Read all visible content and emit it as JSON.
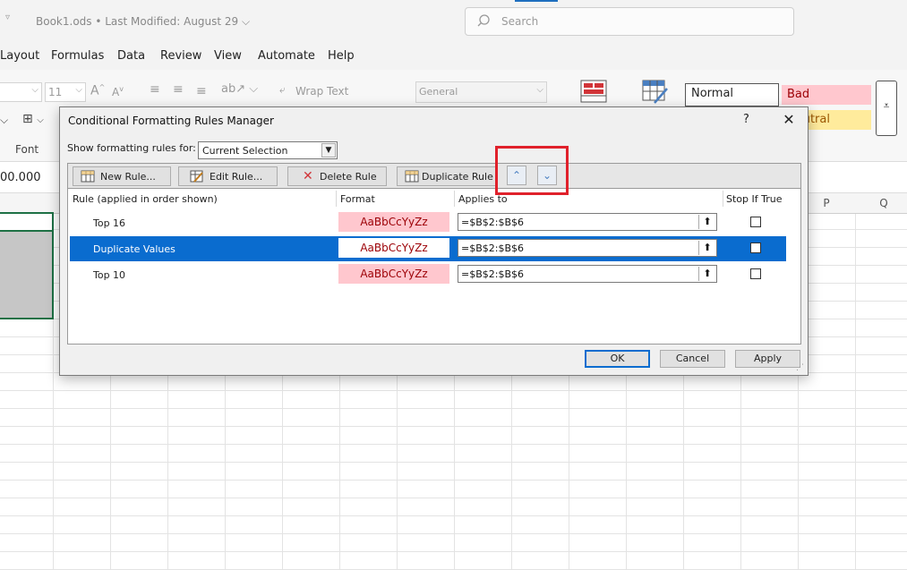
{
  "titlebar": {
    "doc_title": "Book1.ods • Last Modified: August 29 ⌵",
    "search_placeholder": "Search"
  },
  "menu": {
    "items": [
      "Layout",
      "Formulas",
      "Data",
      "Review",
      "View",
      "Automate",
      "Help"
    ]
  },
  "ribbon": {
    "font_size": "11",
    "wrap_text": "Wrap Text",
    "number_format": "General",
    "group_font": "Font",
    "styles": {
      "normal": "Normal",
      "bad": "Bad",
      "neutral": "Neutral"
    }
  },
  "formula_bar": {
    "value": "00.000"
  },
  "grid": {
    "columns": [
      "P",
      "Q"
    ]
  },
  "dialog": {
    "title": "Conditional Formatting Rules Manager",
    "help": "?",
    "close": "✕",
    "show_rules_label": "Show formatting rules for:",
    "scope_value": "Current Selection",
    "buttons": {
      "new_rule": "New Rule...",
      "edit_rule": "Edit Rule...",
      "delete_rule": "Delete Rule",
      "duplicate_rule": "Duplicate Rule",
      "move_up": "⌃",
      "move_down": "⌄"
    },
    "columns": {
      "rule": "Rule (applied in order shown)",
      "format": "Format",
      "applies_to": "Applies to",
      "stop_if_true": "Stop If True"
    },
    "rules": [
      {
        "name": "Top 16",
        "preview": "AaBbCcYyZz",
        "applies_to": "=$B$2:$B$6",
        "selected": false
      },
      {
        "name": "Duplicate Values",
        "preview": "AaBbCcYyZz",
        "applies_to": "=$B$2:$B$6",
        "selected": true
      },
      {
        "name": "Top 10",
        "preview": "AaBbCcYyZz",
        "applies_to": "=$B$2:$B$6",
        "selected": false
      }
    ],
    "footer": {
      "ok": "OK",
      "cancel": "Cancel",
      "apply": "Apply"
    }
  },
  "colors": {
    "accent": "#0a6ccf",
    "highlight": "#e0212b",
    "bad_fill": "#ffc7ce",
    "neutral_fill": "#ffeb9c"
  }
}
